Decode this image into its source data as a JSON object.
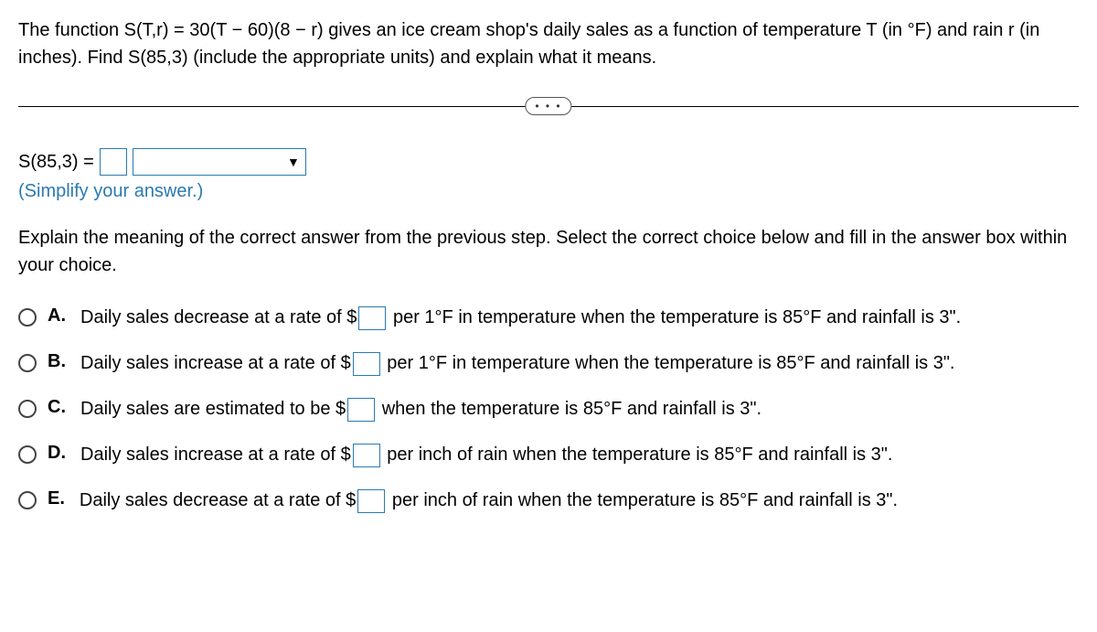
{
  "question": {
    "line1_a": "The function S(T,r) = 30(T − 60)(8 − r) gives an ice cream shop's daily sales as a function of temperature T (in ",
    "deg_f": "°F",
    "line1_b": ") and rain r (in inches). Find S(85,3) (include the appropriate units) and explain what it means."
  },
  "divider_dots": "• • •",
  "answer": {
    "lhs": "S(85,3) =",
    "simplify": "(Simplify your answer.)"
  },
  "explain": "Explain the meaning of the correct answer from the previous step. Select the correct choice below and fill in the answer box within your choice.",
  "choices": {
    "a": {
      "letter": "A.",
      "pre": "Daily sales decrease at a rate of $",
      "post_a": " per 1",
      "deg": "°F",
      "post_b": " in temperature when the temperature is 85",
      "deg2": "°F",
      "post_c": " and rainfall is 3\"."
    },
    "b": {
      "letter": "B.",
      "pre": "Daily sales increase at a rate of $",
      "post_a": " per 1",
      "deg": "°F",
      "post_b": " in temperature when the temperature is 85",
      "deg2": "°F",
      "post_c": " and rainfall is 3\"."
    },
    "c": {
      "letter": "C.",
      "pre": "Daily sales are estimated to be $",
      "post_a": " when the temperature is 85",
      "deg": "°F",
      "post_b": " and rainfall is 3\"."
    },
    "d": {
      "letter": "D.",
      "pre": "Daily sales increase at a rate of $",
      "post_a": " per inch of rain when the temperature is 85",
      "deg": "°F",
      "post_b": " and rainfall is 3\"."
    },
    "e": {
      "letter": "E.",
      "pre": "Daily sales decrease at a rate of $",
      "post_a": " per inch of rain when the temperature is 85",
      "deg": "°F",
      "post_b": " and rainfall is 3\"."
    }
  }
}
